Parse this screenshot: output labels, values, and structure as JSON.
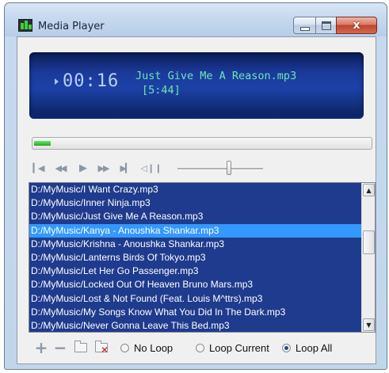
{
  "window": {
    "title": "Media Player",
    "controls": [
      "minimize-icon",
      "maximize-icon",
      "close-icon"
    ],
    "close_glyph": "x"
  },
  "now_playing": {
    "elapsed": "00:16",
    "title": "Just Give Me A Reason.mp3",
    "duration": "[5:44]",
    "progress_fraction": 0.05
  },
  "transport": {
    "buttons": [
      "previous-track-icon",
      "rewind-icon",
      "play-icon",
      "fast-forward-icon",
      "next-track-icon",
      "mute-icon"
    ],
    "volume_fraction": 0.6
  },
  "playlist": {
    "items": [
      "D:/MyMusic/I Want Crazy.mp3",
      "D:/MyMusic/Inner Ninja.mp3",
      "D:/MyMusic/Just Give Me A Reason.mp3",
      "D:/MyMusic/Kanya - Anoushka Shankar.mp3",
      "D:/MyMusic/Krishna - Anoushka Shankar.mp3",
      "D:/MyMusic/Lanterns Birds Of Tokyo.mp3",
      "D:/MyMusic/Let Her Go Passenger.mp3",
      "D:/MyMusic/Locked Out Of Heaven Bruno Mars.mp3",
      "D:/MyMusic/Lost & Not Found (Feat. Louis M^ttrs).mp3",
      "D:/MyMusic/My Songs Know What You Did In The Dark.mp3",
      "D:/MyMusic/Never Gonna Leave This Bed.mp3"
    ],
    "selected_index": 3
  },
  "playlist_tools": {
    "add": "+",
    "remove": "−"
  },
  "loop_options": {
    "no_loop": "No Loop",
    "loop_current": "Loop Current",
    "loop_all": "Loop All",
    "selected": "loop_all"
  },
  "colors": {
    "display_bg": "#1c41a6",
    "display_time": "#b9d0f3",
    "display_track": "#6fe6b2",
    "playlist_bg": "#1f3b8d",
    "playlist_selected": "#3399ff",
    "progress_fill": "#1fa81f"
  }
}
